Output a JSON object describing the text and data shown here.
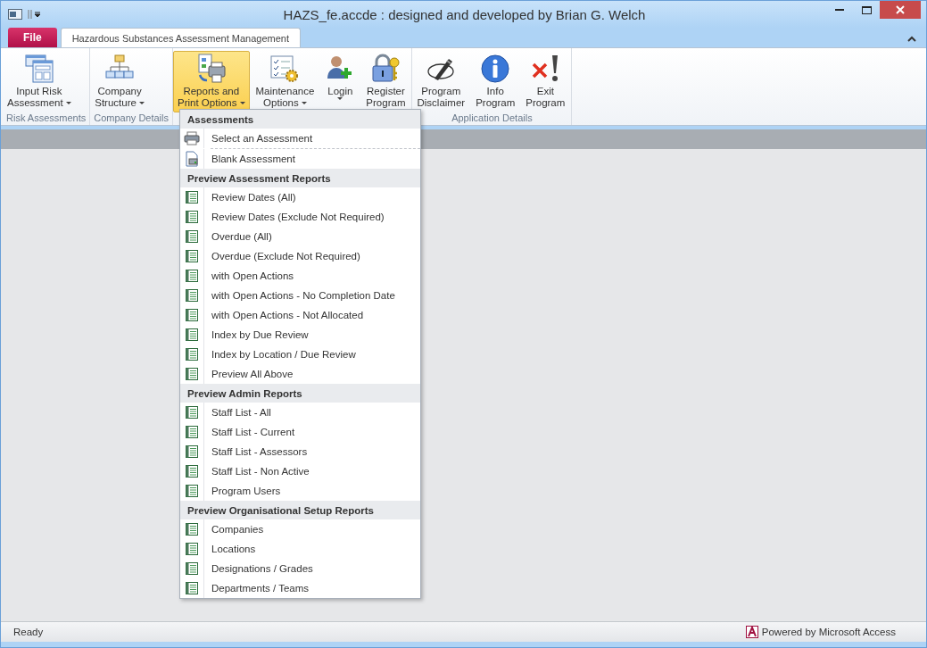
{
  "window": {
    "title": "HAZS_fe.accde : designed and developed by Brian G. Welch"
  },
  "file_tab": {
    "label": "File"
  },
  "tabs": [
    {
      "label": "Hazardous Substances Assessment Management",
      "selected": true
    }
  ],
  "ribbon": {
    "groups": [
      {
        "label": "Risk Assessments",
        "buttons": [
          {
            "lines": [
              "Input Risk",
              "Assessment"
            ],
            "dropdown": true,
            "selected": false
          }
        ]
      },
      {
        "label": "Company Details",
        "buttons": [
          {
            "lines": [
              "Company",
              "Structure"
            ],
            "dropdown": true,
            "selected": false
          }
        ]
      },
      {
        "buttons": [
          {
            "lines": [
              "Reports and",
              "Print Options"
            ],
            "dropdown": true,
            "selected": true
          },
          {
            "lines": [
              "Maintenance",
              "Options"
            ],
            "dropdown": true,
            "selected": false
          },
          {
            "lines": [
              "Login"
            ],
            "dropdown": true,
            "selected": false
          },
          {
            "lines": [
              "Register",
              "Program"
            ],
            "dropdown": false,
            "selected": false
          }
        ]
      },
      {
        "label": "Application Details",
        "buttons": [
          {
            "lines": [
              "Program",
              "Disclaimer"
            ],
            "dropdown": false,
            "selected": false
          },
          {
            "lines": [
              "Info",
              "Program"
            ],
            "dropdown": false,
            "selected": false
          },
          {
            "lines": [
              "Exit",
              "Program"
            ],
            "dropdown": false,
            "selected": false
          }
        ]
      }
    ]
  },
  "menu": {
    "sections": [
      {
        "header": "Assessments",
        "items": [
          {
            "kind": "printer",
            "label": "Select an Assessment",
            "separator_after": true
          },
          {
            "kind": "blank",
            "label": "Blank Assessment",
            "separator_after": false
          }
        ]
      },
      {
        "header": "Preview Assessment Reports",
        "items": [
          {
            "kind": "report",
            "label": "Review Dates (All)",
            "separator_after": false
          },
          {
            "kind": "report",
            "label": "Review Dates (Exclude Not Required)",
            "separator_after": false
          },
          {
            "kind": "report",
            "label": "Overdue (All)",
            "separator_after": false
          },
          {
            "kind": "report",
            "label": "Overdue (Exclude Not Required)",
            "separator_after": false
          },
          {
            "kind": "report",
            "label": "with Open Actions",
            "separator_after": false
          },
          {
            "kind": "report",
            "label": "with Open Actions - No Completion Date",
            "separator_after": false
          },
          {
            "kind": "report",
            "label": "with Open Actions - Not Allocated",
            "separator_after": false
          },
          {
            "kind": "report",
            "label": "Index by Due Review",
            "separator_after": false
          },
          {
            "kind": "report",
            "label": "Index by Location / Due Review",
            "separator_after": false
          },
          {
            "kind": "report",
            "label": "Preview All Above",
            "separator_after": false
          }
        ]
      },
      {
        "header": "Preview Admin Reports",
        "items": [
          {
            "kind": "report",
            "label": "Staff List - All",
            "separator_after": false
          },
          {
            "kind": "report",
            "label": "Staff List - Current",
            "separator_after": false
          },
          {
            "kind": "report",
            "label": "Staff List - Assessors",
            "separator_after": false
          },
          {
            "kind": "report",
            "label": "Staff List - Non Active",
            "separator_after": false
          },
          {
            "kind": "report",
            "label": "Program Users",
            "separator_after": false
          }
        ]
      },
      {
        "header": "Preview Organisational Setup Reports",
        "items": [
          {
            "kind": "report",
            "label": "Companies",
            "separator_after": false
          },
          {
            "kind": "report",
            "label": "Locations",
            "separator_after": false
          },
          {
            "kind": "report",
            "label": "Designations / Grades",
            "separator_after": false
          },
          {
            "kind": "report",
            "label": "Departments / Teams",
            "separator_after": false
          }
        ]
      }
    ]
  },
  "status_bar": {
    "text": "Ready",
    "powered_by": "Powered by Microsoft Access"
  }
}
